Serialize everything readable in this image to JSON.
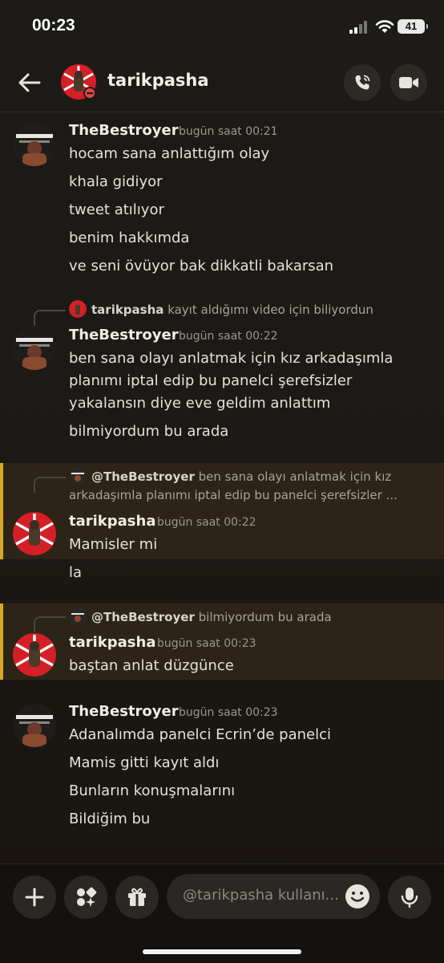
{
  "status": {
    "time": "00:23",
    "battery": "41"
  },
  "header": {
    "title": "tarikpasha",
    "chevron": "›"
  },
  "messages": {
    "m1": {
      "author": "TheBestroyer",
      "time": "bugün saat 00:21",
      "lines": [
        "hocam sana anlattığım olay",
        "khala gidiyor",
        "tweet atılıyor",
        "benim hakkımda",
        "ve seni övüyor bak dikkatli bakarsan"
      ]
    },
    "m2": {
      "reply_author": "tarikpasha",
      "reply_text": "kayıt aldığımı video için biliyordun",
      "author": "TheBestroyer",
      "time": "bugün saat 00:22",
      "lines": [
        "ben sana olayı anlatmak için kız arkadaşımla",
        "planımı iptal edip bu panelci şerefsizler",
        "yakalansın diye eve geldim anlattım",
        "bilmiyordum bu arada"
      ]
    },
    "m3": {
      "reply_author": "@TheBestroyer",
      "reply_text_1": "ben sana olayı anlatmak için kız",
      "reply_text_2": "arkadaşımla planımı iptal edip bu panelci şerefsizler ...",
      "author": "tarikpasha",
      "time": "bugün saat 00:22",
      "lines": [
        "Mamisler mi",
        "la"
      ]
    },
    "m4": {
      "reply_author": "@TheBestroyer",
      "reply_text": "bilmiyordum bu arada",
      "author": "tarikpasha",
      "time": "bugün saat 00:23",
      "lines": [
        "baştan anlat düzgünce"
      ]
    },
    "m5": {
      "author": "TheBestroyer",
      "time": "bugün saat 00:23",
      "lines": [
        "Adanalımda panelci Ecrin’de panelci",
        "Mamis gitti kayıt aldı",
        "Bunların konuşmalarını",
        "Bildiğim bu"
      ]
    }
  },
  "composer": {
    "placeholder": "@tarikpasha kullanı..."
  },
  "colors": {
    "highlight_bar": "#d6a826",
    "avatar_red": "#d41f26",
    "background": "#1b1915"
  },
  "icons": [
    "back-arrow-icon",
    "phone-call-icon",
    "video-camera-icon",
    "plus-icon",
    "apps-icon",
    "gift-icon",
    "emoji-icon",
    "microphone-icon",
    "dnd-status-icon"
  ]
}
